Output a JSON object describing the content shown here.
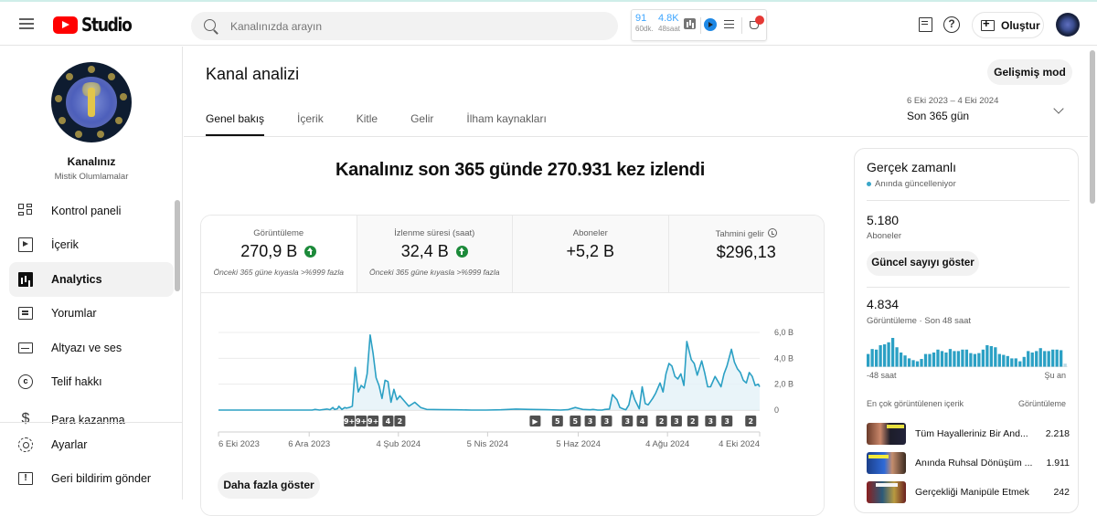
{
  "header": {
    "app_name": "Studio",
    "search_placeholder": "Kanalınızda arayın",
    "extension": {
      "stat1_value": "91",
      "stat1_label": "60dk.",
      "stat2_value": "4.8K",
      "stat2_label": "48saat",
      "badge_color": "#e53935"
    },
    "create_label": "Oluştur"
  },
  "sidebar": {
    "channel_label": "Kanalınız",
    "channel_name": "Mistik Olumlamalar",
    "items": [
      {
        "label": "Kontrol paneli",
        "icon": "dashboard-icon"
      },
      {
        "label": "İçerik",
        "icon": "content-icon"
      },
      {
        "label": "Analytics",
        "icon": "analytics-icon",
        "active": true
      },
      {
        "label": "Yorumlar",
        "icon": "comments-icon"
      },
      {
        "label": "Altyazı ve ses",
        "icon": "subtitles-icon"
      },
      {
        "label": "Telif hakkı",
        "icon": "copyright-icon"
      },
      {
        "label": "Para kazanma",
        "icon": "monetization-icon"
      }
    ],
    "bottom_items": [
      {
        "label": "Ayarlar",
        "icon": "settings-icon"
      },
      {
        "label": "Geri bildirim gönder",
        "icon": "feedback-icon"
      }
    ]
  },
  "main": {
    "title": "Kanal analizi",
    "advanced_mode_label": "Gelişmiş mod",
    "tabs": [
      {
        "label": "Genel bakış",
        "active": true
      },
      {
        "label": "İçerik"
      },
      {
        "label": "Kitle"
      },
      {
        "label": "Gelir"
      },
      {
        "label": "İlham kaynakları"
      }
    ],
    "date_range": {
      "dates": "6 Eki 2023 – 4 Eki 2024",
      "label": "Son 365 gün"
    },
    "headline": "Kanalınız son 365 günde 270.931 kez izlendi",
    "metrics": [
      {
        "label": "Görüntüleme",
        "value": "270,9 B",
        "trend": "up",
        "comparison": "Önceki 365 güne kıyasla >%999 fazla"
      },
      {
        "label": "İzlenme süresi (saat)",
        "value": "32,4 B",
        "trend": "up",
        "comparison": "Önceki 365 güne kıyasla >%999 fazla"
      },
      {
        "label": "Aboneler",
        "value": "+5,2 B",
        "trend": "",
        "comparison": ""
      },
      {
        "label": "Tahmini gelir",
        "value": "$296,13",
        "trend": "",
        "comparison": ""
      }
    ],
    "show_more_label": "Daha fazla göster"
  },
  "realtime": {
    "title": "Gerçek zamanlı",
    "live_label": "Anında güncelleniyor",
    "subscribers_value": "5.180",
    "subscribers_label": "Aboneler",
    "show_count_label": "Güncel sayıyı göster",
    "views_value": "4.834",
    "views_label": "Görüntüleme · Son 48 saat",
    "axis_start": "-48 saat",
    "axis_end": "Şu an",
    "top_content_label": "En çok görüntülenen içerik",
    "top_content_col": "Görüntüleme",
    "hourly_views": [
      45,
      62,
      60,
      75,
      78,
      85,
      100,
      68,
      50,
      40,
      30,
      24,
      20,
      28,
      45,
      45,
      50,
      60,
      55,
      50,
      62,
      55,
      55,
      60,
      60,
      48,
      45,
      48,
      60,
      75,
      72,
      68,
      45,
      42,
      38,
      30,
      30,
      20,
      35,
      55,
      50,
      55,
      65,
      55,
      55,
      60,
      60,
      58,
      12
    ],
    "top_items": [
      {
        "title": "Tüm Hayalleriniz Bir And...",
        "views": "2.218"
      },
      {
        "title": "Anında Ruhsal Dönüşüm ...",
        "views": "1.911"
      },
      {
        "title": "Gerçekliği Manipüle Etmek ...",
        "views": "242"
      }
    ]
  },
  "chart_data": {
    "type": "area",
    "title": "Görüntüleme",
    "xlabel": "",
    "ylabel": "",
    "x_ticks": [
      "6 Eki 2023",
      "6 Ara 2023",
      "4 Şub 2024",
      "5 Nis 2024",
      "5 Haz 2024",
      "4 Ağu 2024",
      "4 Eki 2024"
    ],
    "y_ticks": [
      "0",
      "2,0 B",
      "4,0 B",
      "6,0 B"
    ],
    "ylim": [
      0,
      6000
    ],
    "grid": true,
    "series": [
      {
        "name": "Görüntüleme",
        "color": "#2ba0c4",
        "x_days": [
          0,
          10,
          20,
          30,
          40,
          50,
          60,
          63,
          65,
          68,
          70,
          73,
          75,
          77,
          78,
          80,
          81,
          83,
          85,
          86,
          88,
          90,
          92,
          94,
          96,
          98,
          100,
          102,
          104,
          106,
          108,
          110,
          112,
          114,
          116,
          118,
          120,
          122,
          125,
          128,
          132,
          136,
          140,
          150,
          160,
          170,
          180,
          190,
          200,
          210,
          220,
          230,
          235,
          240,
          245,
          250,
          252,
          255,
          258,
          260,
          263,
          265,
          268,
          270,
          272,
          274,
          276,
          278,
          280,
          283,
          285,
          287,
          289,
          292,
          294,
          297,
          299,
          301,
          303,
          305,
          307,
          309,
          311,
          313,
          315,
          318,
          320,
          322,
          325,
          327,
          329,
          331,
          334,
          336,
          338,
          340,
          342,
          345,
          347,
          349,
          351,
          353,
          355,
          357,
          359,
          361,
          363,
          364
        ],
        "values": [
          0,
          0,
          0,
          0,
          0,
          0,
          0,
          0,
          50,
          0,
          30,
          80,
          30,
          200,
          50,
          100,
          300,
          50,
          200,
          150,
          200,
          300,
          3300,
          1400,
          1900,
          1700,
          2800,
          5800,
          4400,
          2500,
          1900,
          900,
          2300,
          2200,
          600,
          1600,
          800,
          1100,
          700,
          300,
          600,
          200,
          50,
          30,
          20,
          0,
          0,
          20,
          80,
          50,
          30,
          0,
          30,
          200,
          50,
          20,
          50,
          0,
          0,
          50,
          80,
          1200,
          800,
          200,
          100,
          20,
          400,
          1500,
          800,
          100,
          1800,
          500,
          400,
          900,
          1300,
          2100,
          1400,
          2800,
          3600,
          3400,
          2600,
          2400,
          2800,
          1900,
          5300,
          3900,
          3600,
          2700,
          3800,
          2900,
          1800,
          1800,
          2600,
          2200,
          1800,
          2800,
          3400,
          4700,
          3700,
          3200,
          2900,
          2300,
          2100,
          2900,
          2600,
          1900,
          2000,
          1800,
          2000,
          2300
        ]
      }
    ],
    "video_markers": [
      {
        "label": "9+",
        "day": 88
      },
      {
        "label": "9+",
        "day": 96
      },
      {
        "label": "9+",
        "day": 104
      },
      {
        "label": "4",
        "day": 114
      },
      {
        "label": "2",
        "day": 122
      },
      {
        "label": "▶",
        "day": 213
      },
      {
        "label": "5",
        "day": 228
      },
      {
        "label": "5",
        "day": 240
      },
      {
        "label": "3",
        "day": 250
      },
      {
        "label": "3",
        "day": 261
      },
      {
        "label": "3",
        "day": 275
      },
      {
        "label": "4",
        "day": 285
      },
      {
        "label": "2",
        "day": 298
      },
      {
        "label": "3",
        "day": 308
      },
      {
        "label": "2",
        "day": 319
      },
      {
        "label": "3",
        "day": 331
      },
      {
        "label": "3",
        "day": 342
      },
      {
        "label": "2",
        "day": 358
      }
    ]
  }
}
